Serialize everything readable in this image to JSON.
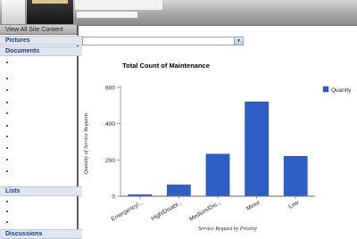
{
  "nav": {
    "view_all": "View All Site Content",
    "sections": [
      {
        "label": "Pictures"
      },
      {
        "label": "Documents"
      },
      {
        "label": "Lists"
      },
      {
        "label": "Discussions"
      }
    ]
  },
  "main": {
    "view_select": {
      "value": ""
    }
  },
  "chart_data": {
    "type": "bar",
    "title": "Total Count of Maintenance",
    "xlabel": "Service Request by Priority",
    "ylabel": "Quantity of Service Requests",
    "categories": [
      "Emergency/...",
      "High/Disabl...",
      "Medium/Dis...",
      "Minor",
      "Low"
    ],
    "series": [
      {
        "name": "Quanity",
        "values": [
          8,
          62,
          232,
          520,
          220
        ],
        "color": "#2f5fc6"
      }
    ],
    "ylim": [
      0,
      600
    ],
    "yticks": [
      0,
      200,
      400,
      600
    ],
    "grid": false,
    "legend": "right"
  }
}
